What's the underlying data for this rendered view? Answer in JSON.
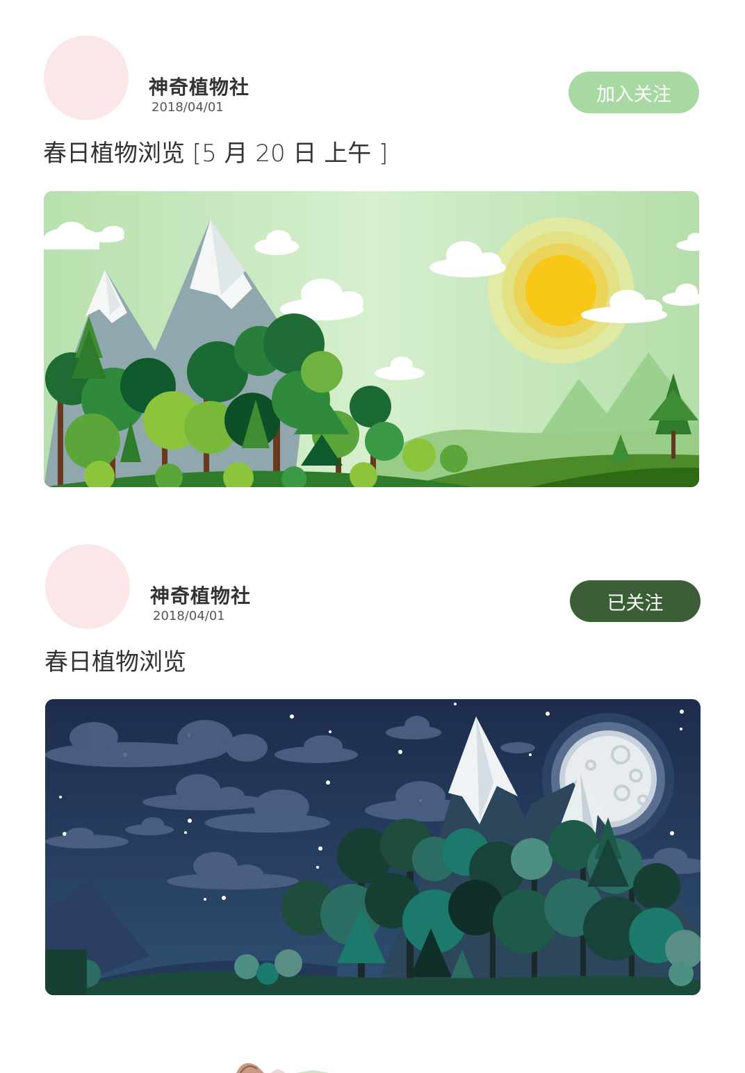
{
  "posts": [
    {
      "author": "神奇植物社",
      "date": "2018/04/01",
      "follow_label": "加入关注",
      "title": "春日植物浏览  [5 月 20 日 上午 ]",
      "follow_color": "#a9d9a2",
      "scene": "daytime-forest-with-sun"
    },
    {
      "author": "神奇植物社",
      "date": "2018/04/01",
      "follow_label": "已关注",
      "title": "春日植物浏览",
      "follow_color": "#3b5e37",
      "scene": "night-forest-with-moon"
    }
  ]
}
